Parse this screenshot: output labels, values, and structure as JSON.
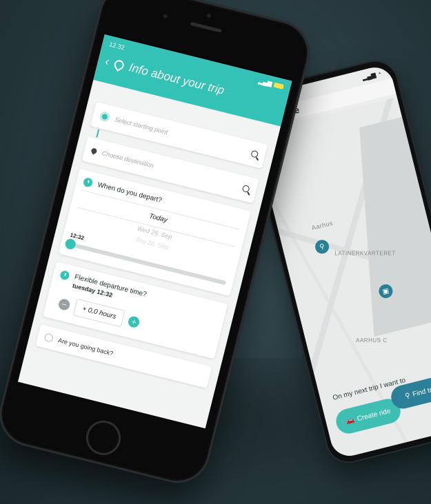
{
  "back_phone": {
    "app_name": "Commute",
    "map_labels": [
      "Aarhus",
      "LATINERKVARTERET",
      "AARHUS C"
    ],
    "prompt": "On my next trip I want to",
    "create_ride": "Create ride",
    "find_trip": "Find trip"
  },
  "front_phone": {
    "status_time": "12.32",
    "header_title": "Info about your trip",
    "start_placeholder": "Select starting point",
    "dest_placeholder": "Choose destination",
    "depart_question": "When do you depart?",
    "picker_selected": "Today",
    "picker_next": "Wed 25. Sep",
    "picker_next2": "Thu 26. Sep",
    "slider_time": "12:32",
    "flexible_question": "Flexible departure time?",
    "flexible_sub": "tuesday 12:32",
    "hours_value": "+ 0,0 hours",
    "return_question": "Are you going back?"
  },
  "colors": {
    "accent": "#33c2b5",
    "dark_accent": "#2b7f98"
  }
}
